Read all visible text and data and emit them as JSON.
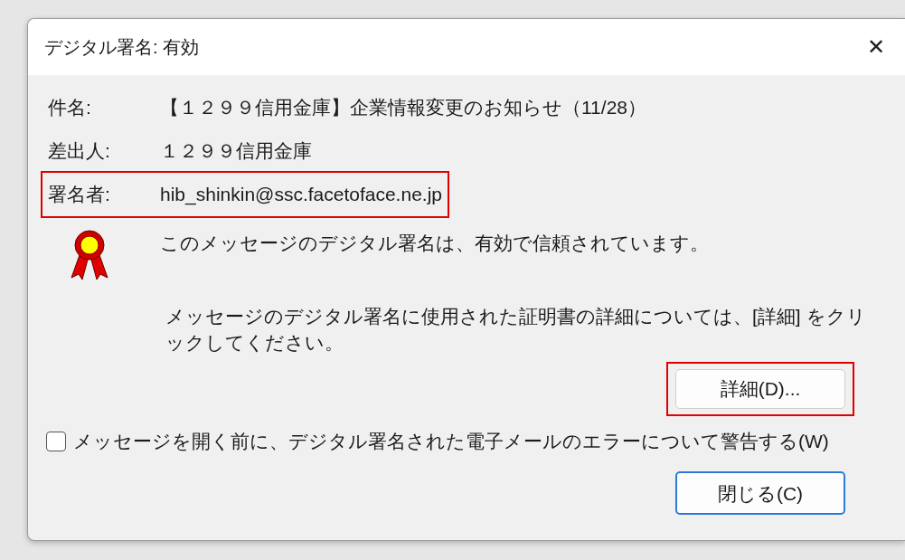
{
  "window": {
    "title": "デジタル署名: 有効",
    "close_glyph": "✕"
  },
  "fields": [
    {
      "label": "件名:",
      "value": "【１２９９信用金庫】企業情報変更のお知らせ（11/28）",
      "highlighted": false
    },
    {
      "label": "差出人:",
      "value": "１２９９信用金庫",
      "highlighted": false
    },
    {
      "label": "署名者:",
      "value": "hib_shinkin@ssc.facetoface.ne.jp",
      "highlighted": true
    }
  ],
  "status_message": "このメッセージのデジタル署名は、有効で信頼されています。",
  "details_message": "メッセージのデジタル署名に使用された証明書の詳細については、[詳細] をクリックしてください。",
  "details_button": {
    "label": "詳細(D)...",
    "highlighted": true
  },
  "warn_checkbox": {
    "label": "メッセージを開く前に、デジタル署名された電子メールのエラーについて警告する(W)",
    "checked": false
  },
  "close_button": {
    "label": "閉じる(C)",
    "default": true
  }
}
